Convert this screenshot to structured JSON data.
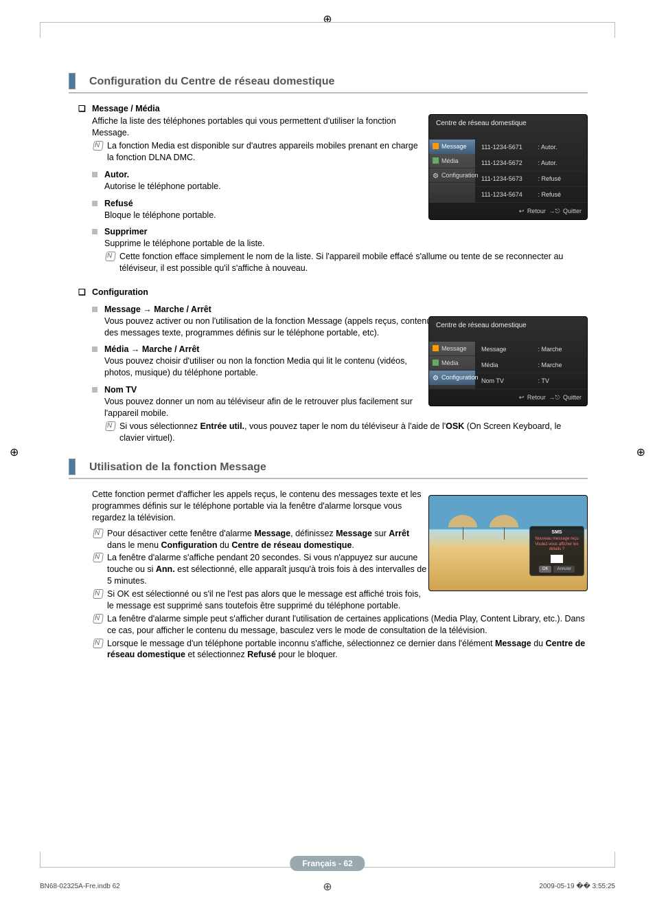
{
  "section1": {
    "title": "Configuration du Centre de réseau domestique",
    "message_media": {
      "heading": "Message / Média",
      "intro": "Affiche la liste des téléphones portables qui vous permettent d'utiliser la fonction Message.",
      "note1": "La fonction Media est disponible sur d'autres appareils mobiles prenant en charge la fonction DLNA DMC.",
      "autor": {
        "h": "Autor.",
        "t": "Autorise le téléphone portable."
      },
      "refuse": {
        "h": "Refusé",
        "t": "Bloque le téléphone portable."
      },
      "supprimer": {
        "h": "Supprimer",
        "t": "Supprime le téléphone portable de la liste.",
        "note": "Cette fonction efface simplement le nom de la liste. Si l'appareil mobile effacé s'allume ou tente de se reconnecter au téléviseur, il est possible qu'il s'affiche à nouveau."
      }
    },
    "configuration": {
      "heading": "Configuration",
      "msg": {
        "h": "Message → Marche / Arrêt",
        "t": "Vous pouvez activer ou non l'utilisation de la fonction Message (appels reçus, contenu des messages texte, programmes définis sur le téléphone portable, etc)."
      },
      "media": {
        "h": "Média → Marche / Arrêt",
        "t": "Vous pouvez choisir d'utiliser ou non la fonction Media qui lit le contenu (vidéos, photos, musique) du téléphone portable."
      },
      "nomtv": {
        "h": "Nom TV",
        "t": "Vous pouvez donner un nom au téléviseur afin de le retrouver plus facilement sur l'appareil mobile.",
        "note_pre": "Si vous sélectionnez ",
        "note_b1": "Entrée util.",
        "note_mid": ", vous pouvez taper le nom du téléviseur à l'aide de l'",
        "note_b2": "OSK",
        "note_post": " (On Screen Keyboard, le clavier virtuel)."
      }
    }
  },
  "section2": {
    "title": "Utilisation de la fonction Message",
    "intro": "Cette fonction permet d'afficher les appels reçus, le contenu des messages texte et les programmes définis sur le téléphone portable via la fenêtre d'alarme lorsque vous regardez la télévision.",
    "n1_pre": "Pour désactiver cette fenêtre d'alarme ",
    "n1_b1": "Message",
    "n1_mid1": ", définissez ",
    "n1_b2": "Message",
    "n1_mid2": " sur ",
    "n1_b3": "Arrêt",
    "n1_mid3": " dans le menu ",
    "n1_b4": "Configuration",
    "n1_mid4": " du ",
    "n1_b5": "Centre de réseau domestique",
    "n1_post": ".",
    "n2_pre": "La fenêtre d'alarme s'affiche pendant 20 secondes. Si vous n'appuyez sur aucune touche ou si ",
    "n2_b": "Ann.",
    "n2_post": " est sélectionné, elle apparaît jusqu'à trois fois à des intervalles de 5 minutes.",
    "n3": "Si OK est sélectionné ou s'il ne l'est pas alors que le message est affiché trois fois, le message est supprimé sans toutefois être supprimé du téléphone portable.",
    "n4": "La fenêtre d'alarme simple peut s'afficher durant l'utilisation de certaines applications (Media Play, Content Library, etc.). Dans ce cas, pour afficher le contenu du message, basculez vers le mode de consultation de la télévision.",
    "n5_pre": "Lorsque le message d'un téléphone portable inconnu s'affiche, sélectionnez ce dernier dans l'élément ",
    "n5_b1": "Message",
    "n5_mid1": " du ",
    "n5_b2": "Centre de réseau domestique",
    "n5_mid2": " et sélectionnez ",
    "n5_b3": "Refusé",
    "n5_post": " pour le bloquer."
  },
  "osd1": {
    "title": "Centre de réseau domestique",
    "nav": [
      "Message",
      "Média",
      "Configuration"
    ],
    "rows": [
      {
        "id": "111-1234-5671",
        "state": ": Autor."
      },
      {
        "id": "111-1234-5672",
        "state": ": Autor."
      },
      {
        "id": "111-1234-5673",
        "state": ": Refusé"
      },
      {
        "id": "111-1234-5674",
        "state": ": Refusé"
      }
    ],
    "retour": "Retour",
    "quitter": "Quitter"
  },
  "osd2": {
    "title": "Centre de réseau domestique",
    "nav": [
      "Message",
      "Média",
      "Configuration"
    ],
    "rows": [
      {
        "k": "Message",
        "v": ": Marche"
      },
      {
        "k": "Média",
        "v": ": Marche"
      },
      {
        "k": "Nom TV",
        "v": ": TV"
      }
    ],
    "retour": "Retour",
    "quitter": "Quitter"
  },
  "alert": {
    "title": "SMS",
    "l1": "Nouveau message reçu",
    "l2": "Voulez-vous afficher les détails ?",
    "ok": "OK",
    "cancel": "Annuler"
  },
  "page_indicator": "Français - 62",
  "footer": {
    "left": "BN68-02325A-Fre.indb   62",
    "right": "2009-05-19   �� 3:55:25"
  },
  "return_glyph": "↩",
  "exit_glyph": "→⎋"
}
